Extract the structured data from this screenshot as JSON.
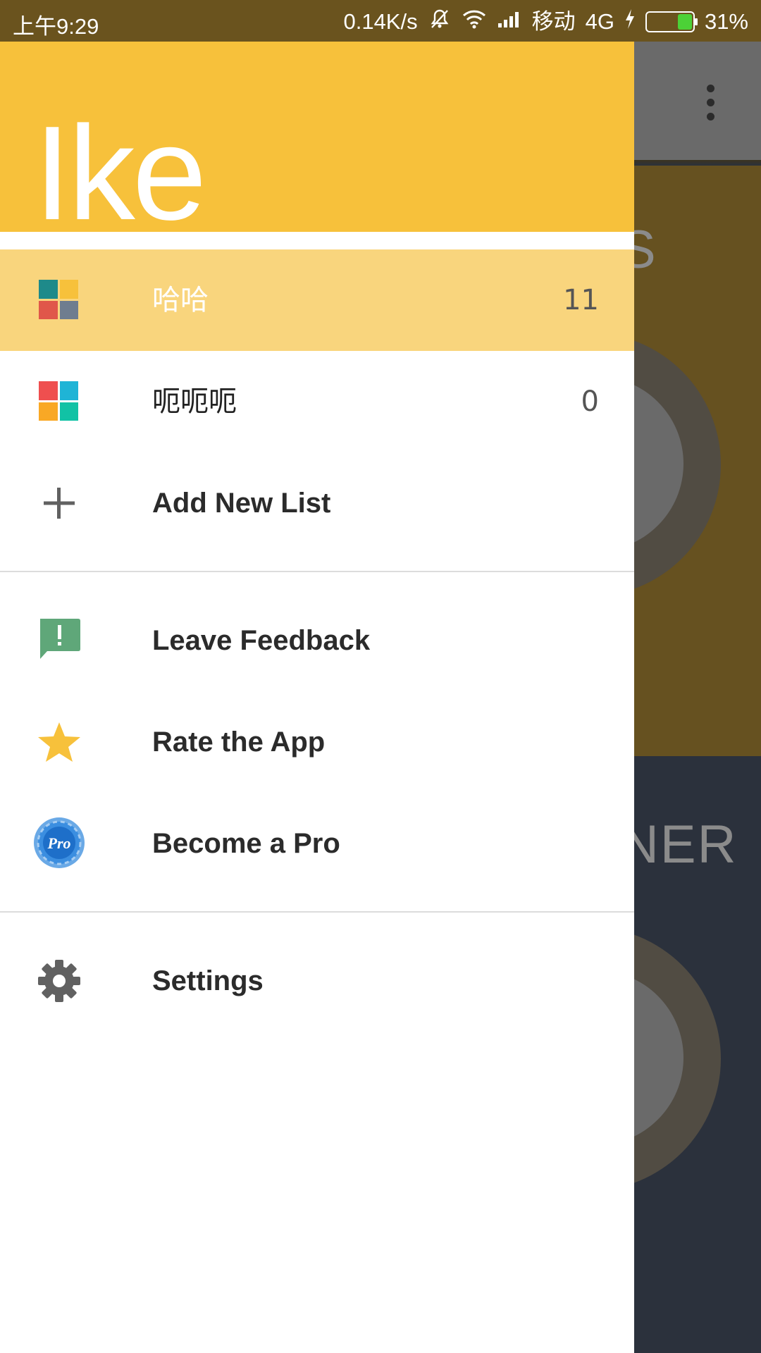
{
  "status_bar": {
    "time": "上午9:29",
    "speed": "0.14K/s",
    "carrier": "移动",
    "network": "4G",
    "battery": "31%",
    "battery_level": 0.31
  },
  "drawer": {
    "app_name": "Ike",
    "lists": [
      {
        "label": "哈哈",
        "count": "11",
        "active": true,
        "colors": [
          "#1e8a8a",
          "#f7c13b",
          "#e0574a",
          "#6f7d8f"
        ]
      },
      {
        "label": "呃呃呃",
        "count": "0",
        "active": false,
        "colors": [
          "#ef4f4f",
          "#1fb4d6",
          "#f9a825",
          "#11c2a5"
        ]
      }
    ],
    "add_list_label": "Add New List",
    "feedback_label": "Leave Feedback",
    "rate_label": "Rate the App",
    "pro_label": "Become a Pro",
    "pro_badge_text": "Pro",
    "settings_label": "Settings"
  },
  "background": {
    "label_top_fragment": "S",
    "label_bottom_fragment": "NER"
  },
  "colors": {
    "header": "#f7c13b",
    "active_row": "#f9d57d",
    "status_bar": "#6a531e"
  }
}
